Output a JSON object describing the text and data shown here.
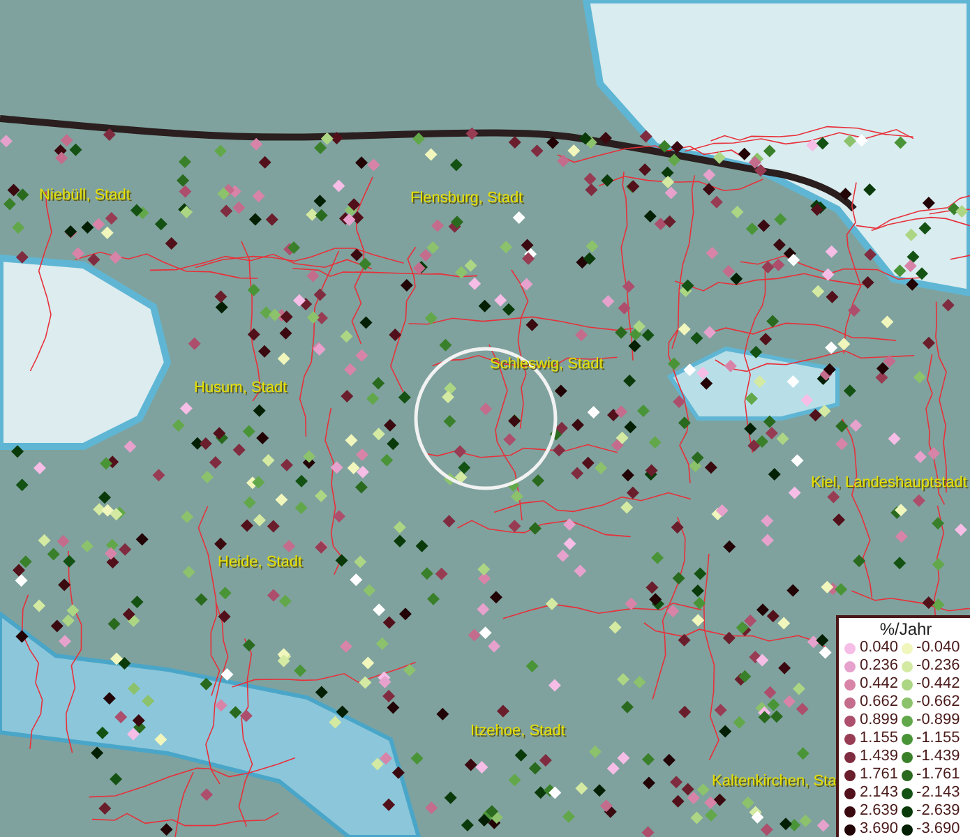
{
  "map": {
    "places": [
      {
        "name": "Niebüll, Stadt"
      },
      {
        "name": "Flensburg, Stadt"
      },
      {
        "name": "Schleswig, Stadt"
      },
      {
        "name": "Husum, Stadt"
      },
      {
        "name": "Kiel, Landeshauptstadt"
      },
      {
        "name": "Heide, Stadt"
      },
      {
        "name": "Itzehoe, Stadt"
      },
      {
        "name": "Kaltenkirchen, Sta"
      }
    ]
  },
  "legend": {
    "title": "%/Jahr",
    "columns": [
      {
        "entries": [
          {
            "value": "0.040",
            "color": "#f6bde6"
          },
          {
            "value": "0.236",
            "color": "#e6a2cc"
          },
          {
            "value": "0.442",
            "color": "#d884a8"
          },
          {
            "value": "0.662",
            "color": "#c46c8c"
          },
          {
            "value": "0.899",
            "color": "#ac4e6c"
          },
          {
            "value": "1.155",
            "color": "#983c54"
          },
          {
            "value": "1.439",
            "color": "#802c40"
          },
          {
            "value": "1.761",
            "color": "#6a1e2c"
          },
          {
            "value": "2.143",
            "color": "#52101a"
          },
          {
            "value": "2.639",
            "color": "#3a0a10"
          },
          {
            "value": "3.690",
            "color": "#220406"
          }
        ]
      },
      {
        "entries": [
          {
            "value": "-0.040",
            "color": "#f0f6bc"
          },
          {
            "value": "-0.236",
            "color": "#d4eaa2"
          },
          {
            "value": "-0.442",
            "color": "#acd684"
          },
          {
            "value": "-0.662",
            "color": "#8cc26c"
          },
          {
            "value": "-0.899",
            "color": "#62a84a"
          },
          {
            "value": "-1.155",
            "color": "#4a9438"
          },
          {
            "value": "-1.439",
            "color": "#3a802a"
          },
          {
            "value": "-1.761",
            "color": "#2a6a1f"
          },
          {
            "value": "-2.143",
            "color": "#145214"
          },
          {
            "value": "-2.639",
            "color": "#0a3a0a"
          },
          {
            "value": "-3.690",
            "color": "#042004"
          }
        ]
      }
    ]
  }
}
